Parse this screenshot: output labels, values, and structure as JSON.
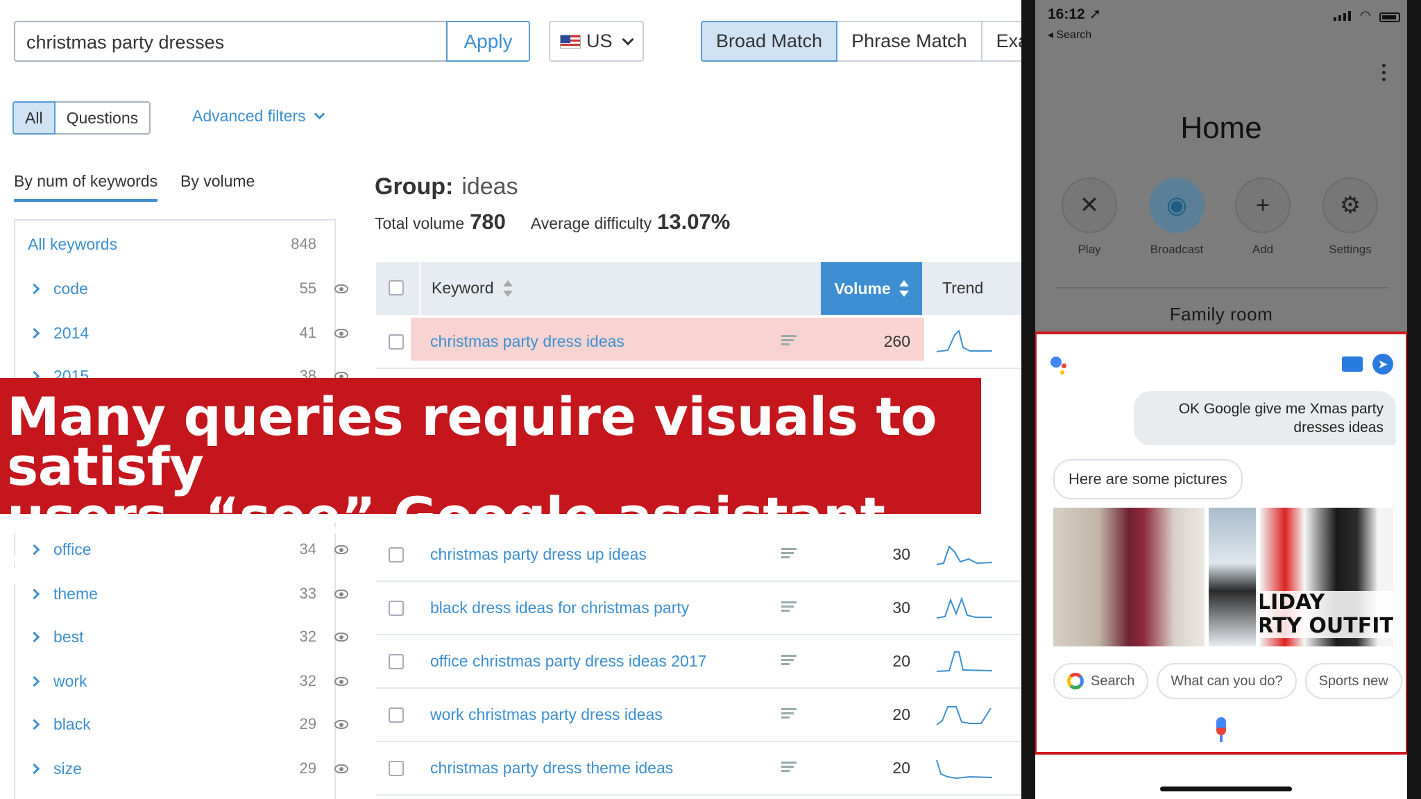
{
  "tool": {
    "search": {
      "value": "christmas party dresses",
      "apply_label": "Apply"
    },
    "country": {
      "code": "US"
    },
    "match_tabs": [
      "Broad Match",
      "Phrase Match",
      "Exa"
    ],
    "filters": {
      "all_label": "All",
      "questions_label": "Questions",
      "advanced_label": "Advanced filters"
    },
    "sort_tabs": {
      "by_keywords": "By num of keywords",
      "by_volume": "By volume"
    },
    "groups": {
      "all": {
        "label": "All keywords",
        "count": "848"
      },
      "items": [
        {
          "label": "code",
          "count": "55"
        },
        {
          "label": "2014",
          "count": "41"
        },
        {
          "label": "2015",
          "count": "38"
        },
        {
          "label": "office",
          "count": "34"
        },
        {
          "label": "theme",
          "count": "33"
        },
        {
          "label": "best",
          "count": "32"
        },
        {
          "label": "work",
          "count": "32"
        },
        {
          "label": "black",
          "count": "29"
        },
        {
          "label": "size",
          "count": "29"
        }
      ]
    },
    "group_header": {
      "prefix": "Group:",
      "name": "ideas",
      "total_volume_label": "Total volume",
      "total_volume": "780",
      "avg_difficulty_label": "Average difficulty",
      "avg_difficulty": "13.07%"
    },
    "table": {
      "headers": {
        "keyword": "Keyword",
        "volume": "Volume",
        "trend": "Trend"
      },
      "rows": [
        {
          "keyword": "christmas party dress ideas",
          "volume": "260",
          "highlighted": true
        },
        {
          "keyword": "christmas party dress up ideas",
          "volume": "30"
        },
        {
          "keyword": "black dress ideas for christmas party",
          "volume": "30"
        },
        {
          "keyword": "office christmas party dress ideas 2017",
          "volume": "20"
        },
        {
          "keyword": "work christmas party dress ideas",
          "volume": "20"
        },
        {
          "keyword": "christmas party dress theme ideas",
          "volume": "20"
        }
      ]
    }
  },
  "banner": {
    "line1": "Many queries require visuals to satisfy",
    "line2": "users, “see” Google assistant answers"
  },
  "phone": {
    "status": {
      "time": "16:12",
      "back_label": "◂ Search"
    },
    "home_title": "Home",
    "quick_actions": [
      {
        "label": "Play",
        "icon": "play-muted-icon"
      },
      {
        "label": "Broadcast",
        "icon": "broadcast-icon"
      },
      {
        "label": "Add",
        "icon": "plus-icon"
      },
      {
        "label": "Settings",
        "icon": "gear-icon"
      }
    ],
    "room": "Family room",
    "assistant": {
      "user_query": "OK Google give me Xmas party dresses ideas",
      "reply": "Here are some pictures",
      "image_caption": "LIDAY\nRTY OUTFITS",
      "chips": [
        "Search",
        "What can you do?",
        "Sports new"
      ]
    }
  },
  "colors": {
    "accent": "#3d8fd1",
    "banner": "#c4161c",
    "highlight_row": "#f7d4d2",
    "assistant_border": "#d0181e"
  }
}
